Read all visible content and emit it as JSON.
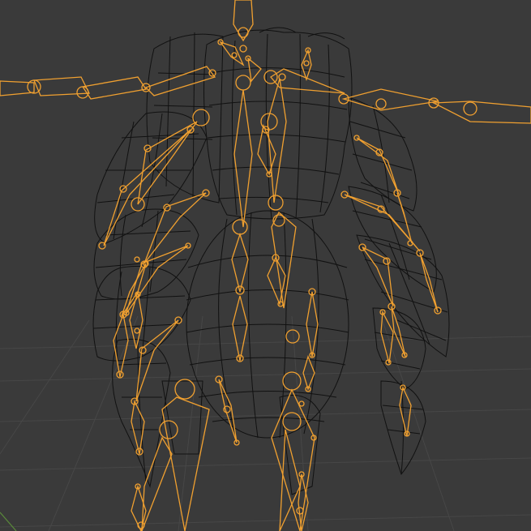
{
  "viewport": {
    "background": "#3a3a3a",
    "grid_color": "#474747",
    "mesh_wire_color": "#111111",
    "bone_color": "#f0a030",
    "green_axis_color": "#5a8a3a"
  },
  "objects": {
    "mesh": "creature-wireframe-mesh",
    "armature": "creature-armature"
  }
}
